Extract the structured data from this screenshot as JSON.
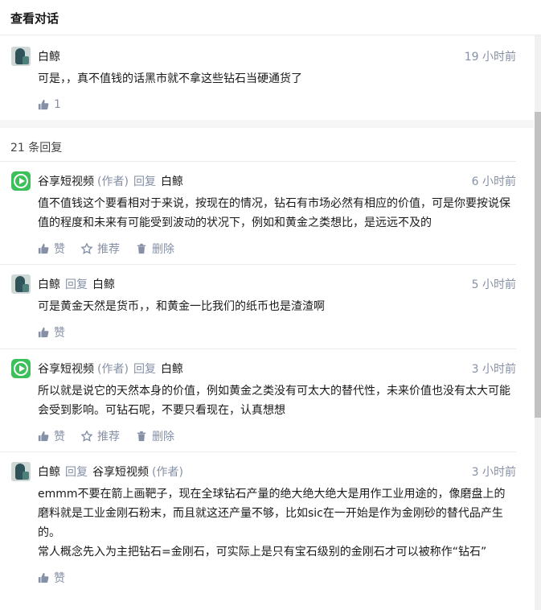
{
  "header": {
    "title": "查看对话"
  },
  "root_comment": {
    "author": "白鲸",
    "time": "19 小时前",
    "text": "可是，，真不值钱的话黑市就不拿这些钻石当硬通货了",
    "like_count": "1",
    "avatar_icon": "whale-avatar"
  },
  "replies_header": {
    "count_label": "21 条回复"
  },
  "replies": [
    {
      "author": "谷享短视频",
      "author_tag": "(作者)",
      "reply_word": "回复",
      "target": "白鲸",
      "time": "6 小时前",
      "text": "值不值钱这个要看相对于来说，按现在的情况，钻石有市场必然有相应的价值，可是你要按说保值的程度和未来有可能受到波动的状况下，例如和黄金之类想比，是远远不及的",
      "actions": {
        "like": "赞",
        "recommend": "推荐",
        "delete": "删除"
      },
      "avatar_icon": "video-avatar"
    },
    {
      "author": "白鲸",
      "reply_word": "回复",
      "target": "白鲸",
      "time": "5 小时前",
      "text": "可是黄金天然是货币，，和黄金一比我们的纸币也是渣渣啊",
      "actions": {
        "like": "赞"
      },
      "avatar_icon": "whale-avatar"
    },
    {
      "author": "谷享短视频",
      "author_tag": "(作者)",
      "reply_word": "回复",
      "target": "白鲸",
      "time": "3 小时前",
      "text": "所以就是说它的天然本身的价值，例如黄金之类没有可太大的替代性，未来价值也没有太大可能会受到影响。可钻石呢，不要只看现在，认真想想",
      "actions": {
        "like": "赞",
        "recommend": "推荐",
        "delete": "删除"
      },
      "avatar_icon": "video-avatar"
    },
    {
      "author": "白鲸",
      "reply_word": "回复",
      "target": "谷享短视频",
      "target_tag": "(作者)",
      "time": "3 小时前",
      "text": "emmm不要在箭上画靶子，现在全球钻石产量的绝大绝大绝大是用作工业用途的，像磨盘上的磨料就是工业金刚石粉末，而且就这还产量不够，比如sic在一开始是作为金刚砂的替代品产生的。\n常人概念先入为主把钻石=金刚石，可实际上是只有宝石级别的金刚石才可以被称作“钻石”",
      "actions": {
        "like": "赞"
      },
      "avatar_icon": "whale-avatar"
    }
  ],
  "colors": {
    "accent_gray": "#8590a6",
    "video_green": "#3cc15a",
    "band": "#f6f6f6"
  }
}
